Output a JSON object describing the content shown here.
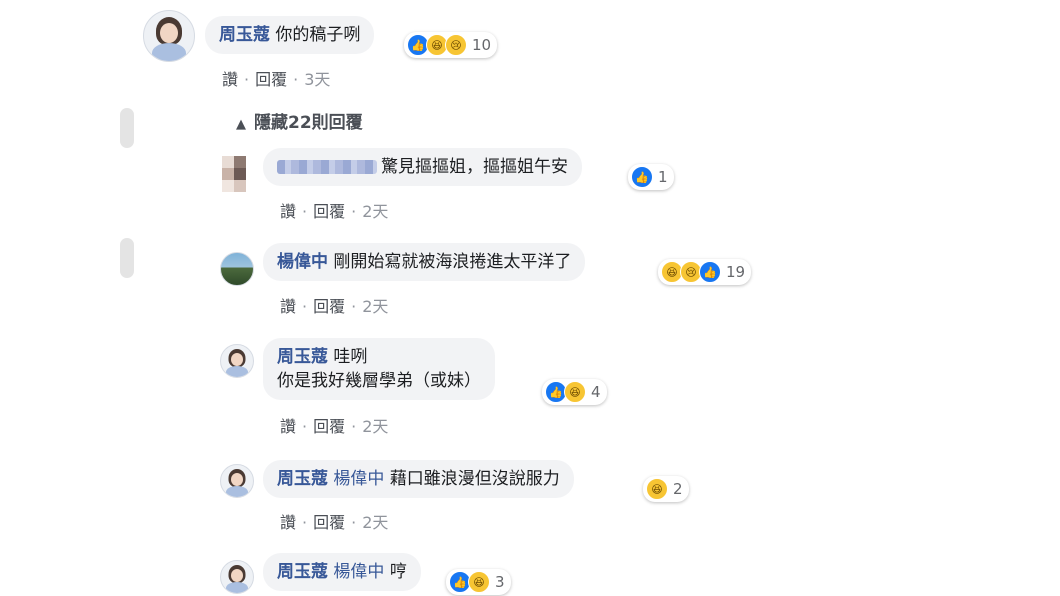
{
  "actions": {
    "like": "讚",
    "reply": "回覆",
    "sep": "·"
  },
  "comment": {
    "author": "周玉蔻",
    "text": "你的稿子咧",
    "reaction_count": "10",
    "time": "3天"
  },
  "toggle": {
    "icon": "chevron-up-icon",
    "label": "隱藏22則回覆"
  },
  "replies": [
    {
      "author": "",
      "text": "驚見摳摳姐，摳摳姐午安",
      "reaction_count": "1",
      "time": "2天"
    },
    {
      "author": "楊偉中",
      "text": "剛開始寫就被海浪捲進太平洋了",
      "reaction_count": "19",
      "time": "2天"
    },
    {
      "author": "周玉蔻",
      "text": "哇咧",
      "text2": "你是我好幾層學弟（或妹）",
      "reaction_count": "4",
      "time": "2天"
    },
    {
      "author": "周玉蔻",
      "mention": "楊偉中",
      "text": "藉口雖浪漫但沒說服力",
      "reaction_count": "2",
      "time": "2天"
    },
    {
      "author": "周玉蔻",
      "mention": "楊偉中",
      "text": "哼",
      "reaction_count": "3"
    }
  ],
  "colors": {
    "name": "#385898",
    "bubble": "#f2f3f5",
    "like": "#1877f2",
    "emoji": "#f7c533"
  }
}
